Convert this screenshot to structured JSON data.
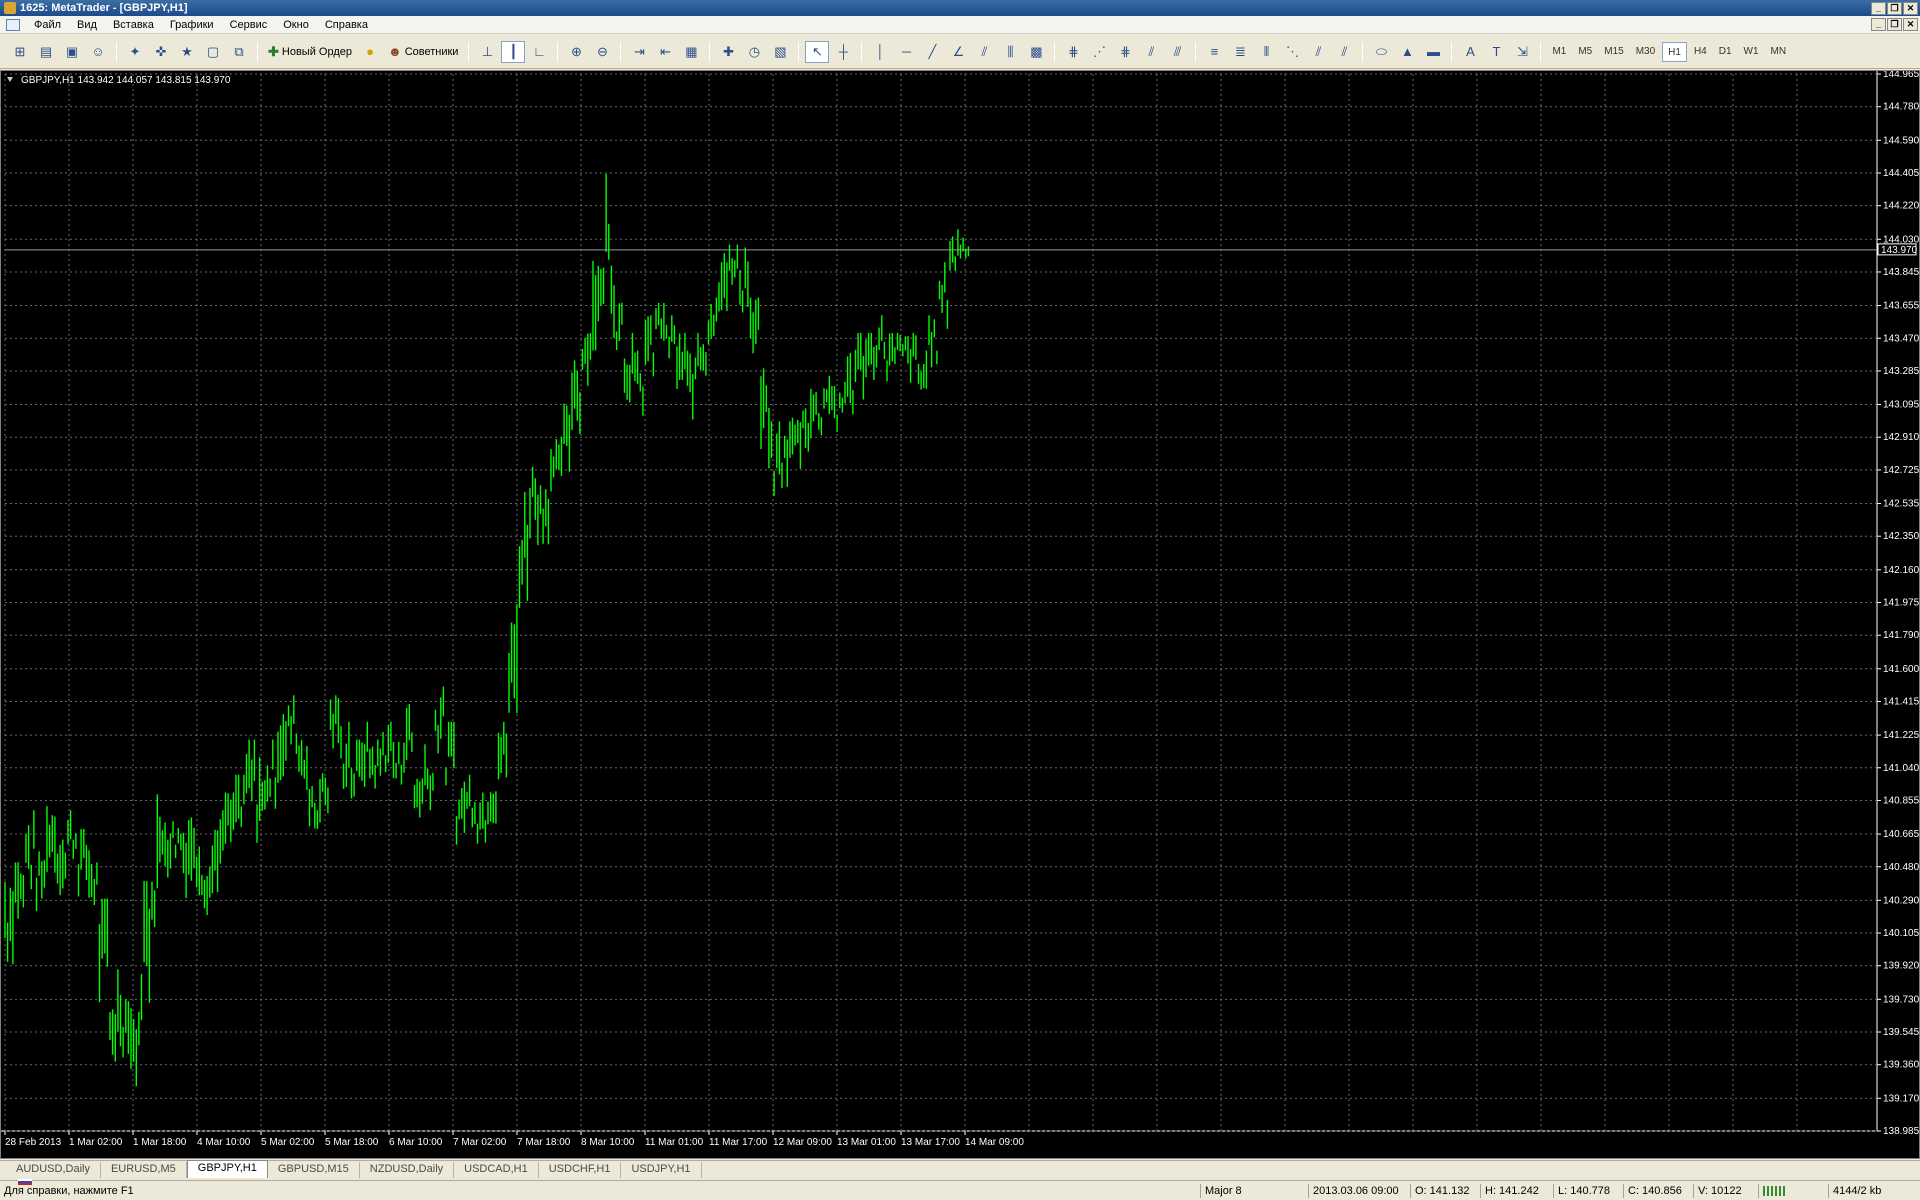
{
  "window": {
    "title": "1625: MetaTrader - [GBPJPY,H1]"
  },
  "menu": [
    "Файл",
    "Вид",
    "Вставка",
    "Графики",
    "Сервис",
    "Окно",
    "Справка"
  ],
  "toolbar": {
    "new_order_label": "Новый Ордер",
    "experts_label": "Советники",
    "timeframes": [
      "M1",
      "M5",
      "M15",
      "M30",
      "H1",
      "H4",
      "D1",
      "W1",
      "MN"
    ],
    "selected_timeframe": "H1"
  },
  "chart": {
    "header": "GBPJPY,H1  143.942 144.057 143.815 143.970",
    "current_price_label": "143.970",
    "current_price": 143.97,
    "colors": {
      "background": "#000000",
      "bars": "#00ff00",
      "grid": "#6a6a6a",
      "axis_text": "#ffffff"
    }
  },
  "chart_data": {
    "type": "bar",
    "symbol": "GBPJPY",
    "timeframe": "H1",
    "ylim": [
      138.985,
      144.965
    ],
    "grid": true,
    "y_ticks": [
      "144.965",
      "144.780",
      "144.590",
      "144.405",
      "144.220",
      "144.030",
      "143.845",
      "143.655",
      "143.470",
      "143.285",
      "143.095",
      "142.910",
      "142.725",
      "142.535",
      "142.350",
      "142.160",
      "141.975",
      "141.790",
      "141.600",
      "141.415",
      "141.225",
      "141.040",
      "140.855",
      "140.665",
      "140.480",
      "140.290",
      "140.105",
      "139.920",
      "139.730",
      "139.545",
      "139.360",
      "139.170",
      "138.985"
    ],
    "x_ticks": [
      "28 Feb 2013",
      "1 Mar 02:00",
      "1 Mar 18:00",
      "4 Mar 10:00",
      "5 Mar 02:00",
      "5 Mar 18:00",
      "6 Mar 10:00",
      "7 Mar 02:00",
      "7 Mar 18:00",
      "8 Mar 10:00",
      "11 Mar 01:00",
      "11 Mar 17:00",
      "12 Mar 09:00",
      "13 Mar 01:00",
      "13 Mar 17:00",
      "14 Mar 09:00"
    ],
    "bars": [
      [
        139.9,
        140.5
      ],
      [
        140.1,
        140.6
      ],
      [
        140.3,
        140.8
      ],
      [
        140.2,
        140.6
      ],
      [
        140.4,
        140.9
      ],
      [
        140.3,
        140.7
      ],
      [
        140.5,
        140.8
      ],
      [
        140.3,
        140.7
      ],
      [
        140.2,
        140.6
      ],
      [
        139.6,
        140.3
      ],
      [
        139.3,
        139.9
      ],
      [
        139.4,
        139.8
      ],
      [
        139.2,
        139.7
      ],
      [
        139.6,
        140.4
      ],
      [
        140.1,
        140.9
      ],
      [
        140.4,
        140.9
      ],
      [
        140.5,
        140.8
      ],
      [
        140.3,
        140.8
      ],
      [
        140.3,
        140.7
      ],
      [
        140.2,
        140.6
      ],
      [
        140.3,
        140.8
      ],
      [
        140.5,
        140.9
      ],
      [
        140.6,
        141.0
      ],
      [
        140.7,
        141.2
      ],
      [
        140.6,
        141.1
      ],
      [
        140.8,
        141.2
      ],
      [
        140.9,
        141.4
      ],
      [
        141.1,
        141.45
      ],
      [
        140.9,
        141.3
      ],
      [
        140.6,
        141.0
      ],
      [
        140.7,
        141.1
      ],
      [
        141.1,
        141.45
      ],
      [
        140.9,
        141.3
      ],
      [
        140.8,
        141.2
      ],
      [
        140.9,
        141.3
      ],
      [
        140.9,
        141.2
      ],
      [
        141.0,
        141.3
      ],
      [
        140.9,
        141.2
      ],
      [
        141.0,
        141.4
      ],
      [
        140.7,
        141.1
      ],
      [
        140.8,
        141.2
      ],
      [
        141.1,
        141.5
      ],
      [
        140.9,
        141.3
      ],
      [
        140.6,
        141.0
      ],
      [
        140.7,
        141.0
      ],
      [
        140.6,
        140.9
      ],
      [
        140.7,
        141.1
      ],
      [
        140.9,
        141.3
      ],
      [
        141.1,
        142.0
      ],
      [
        141.9,
        142.6
      ],
      [
        142.3,
        142.9
      ],
      [
        142.3,
        142.7
      ],
      [
        142.5,
        142.9
      ],
      [
        142.6,
        143.1
      ],
      [
        142.9,
        143.4
      ],
      [
        143.2,
        143.6
      ],
      [
        143.3,
        144.0
      ],
      [
        143.6,
        144.4
      ],
      [
        143.4,
        143.8
      ],
      [
        143.1,
        143.5
      ],
      [
        143.0,
        143.4
      ],
      [
        143.2,
        143.6
      ],
      [
        143.4,
        143.7
      ],
      [
        143.3,
        143.6
      ],
      [
        143.1,
        143.5
      ],
      [
        143.0,
        143.4
      ],
      [
        143.2,
        143.6
      ],
      [
        143.4,
        143.8
      ],
      [
        143.6,
        144.1
      ],
      [
        143.7,
        144.0
      ],
      [
        143.6,
        144.0
      ],
      [
        143.3,
        143.7
      ],
      [
        142.7,
        143.3
      ],
      [
        142.5,
        143.0
      ],
      [
        142.6,
        143.0
      ],
      [
        142.7,
        143.1
      ],
      [
        142.8,
        143.2
      ],
      [
        142.9,
        143.2
      ],
      [
        143.0,
        143.3
      ],
      [
        142.9,
        143.2
      ],
      [
        143.0,
        143.4
      ],
      [
        143.1,
        143.5
      ],
      [
        143.2,
        143.5
      ],
      [
        143.3,
        143.6
      ],
      [
        143.2,
        143.5
      ],
      [
        143.3,
        143.5
      ],
      [
        143.2,
        143.5
      ],
      [
        143.1,
        143.4
      ],
      [
        143.3,
        143.6
      ],
      [
        143.5,
        143.9
      ],
      [
        143.8,
        144.1
      ],
      [
        143.9,
        144.05
      ]
    ]
  },
  "tabs": [
    "AUDUSD,Daily",
    "EURUSD,M5",
    "GBPJPY,H1",
    "GBPUSD,M15",
    "NZDUSD,Daily",
    "USDCAD,H1",
    "USDCHF,H1",
    "USDJPY,H1"
  ],
  "active_tab": "GBPJPY,H1",
  "status": {
    "help": "Для справки, нажмите F1",
    "profile": "Major 8",
    "datetime": "2013.03.06 09:00",
    "open": "O: 141.132",
    "high": "H: 141.242",
    "low": "L: 140.778",
    "close": "C: 140.856",
    "volume": "V: 10122",
    "traffic": "4144/2 kb"
  }
}
